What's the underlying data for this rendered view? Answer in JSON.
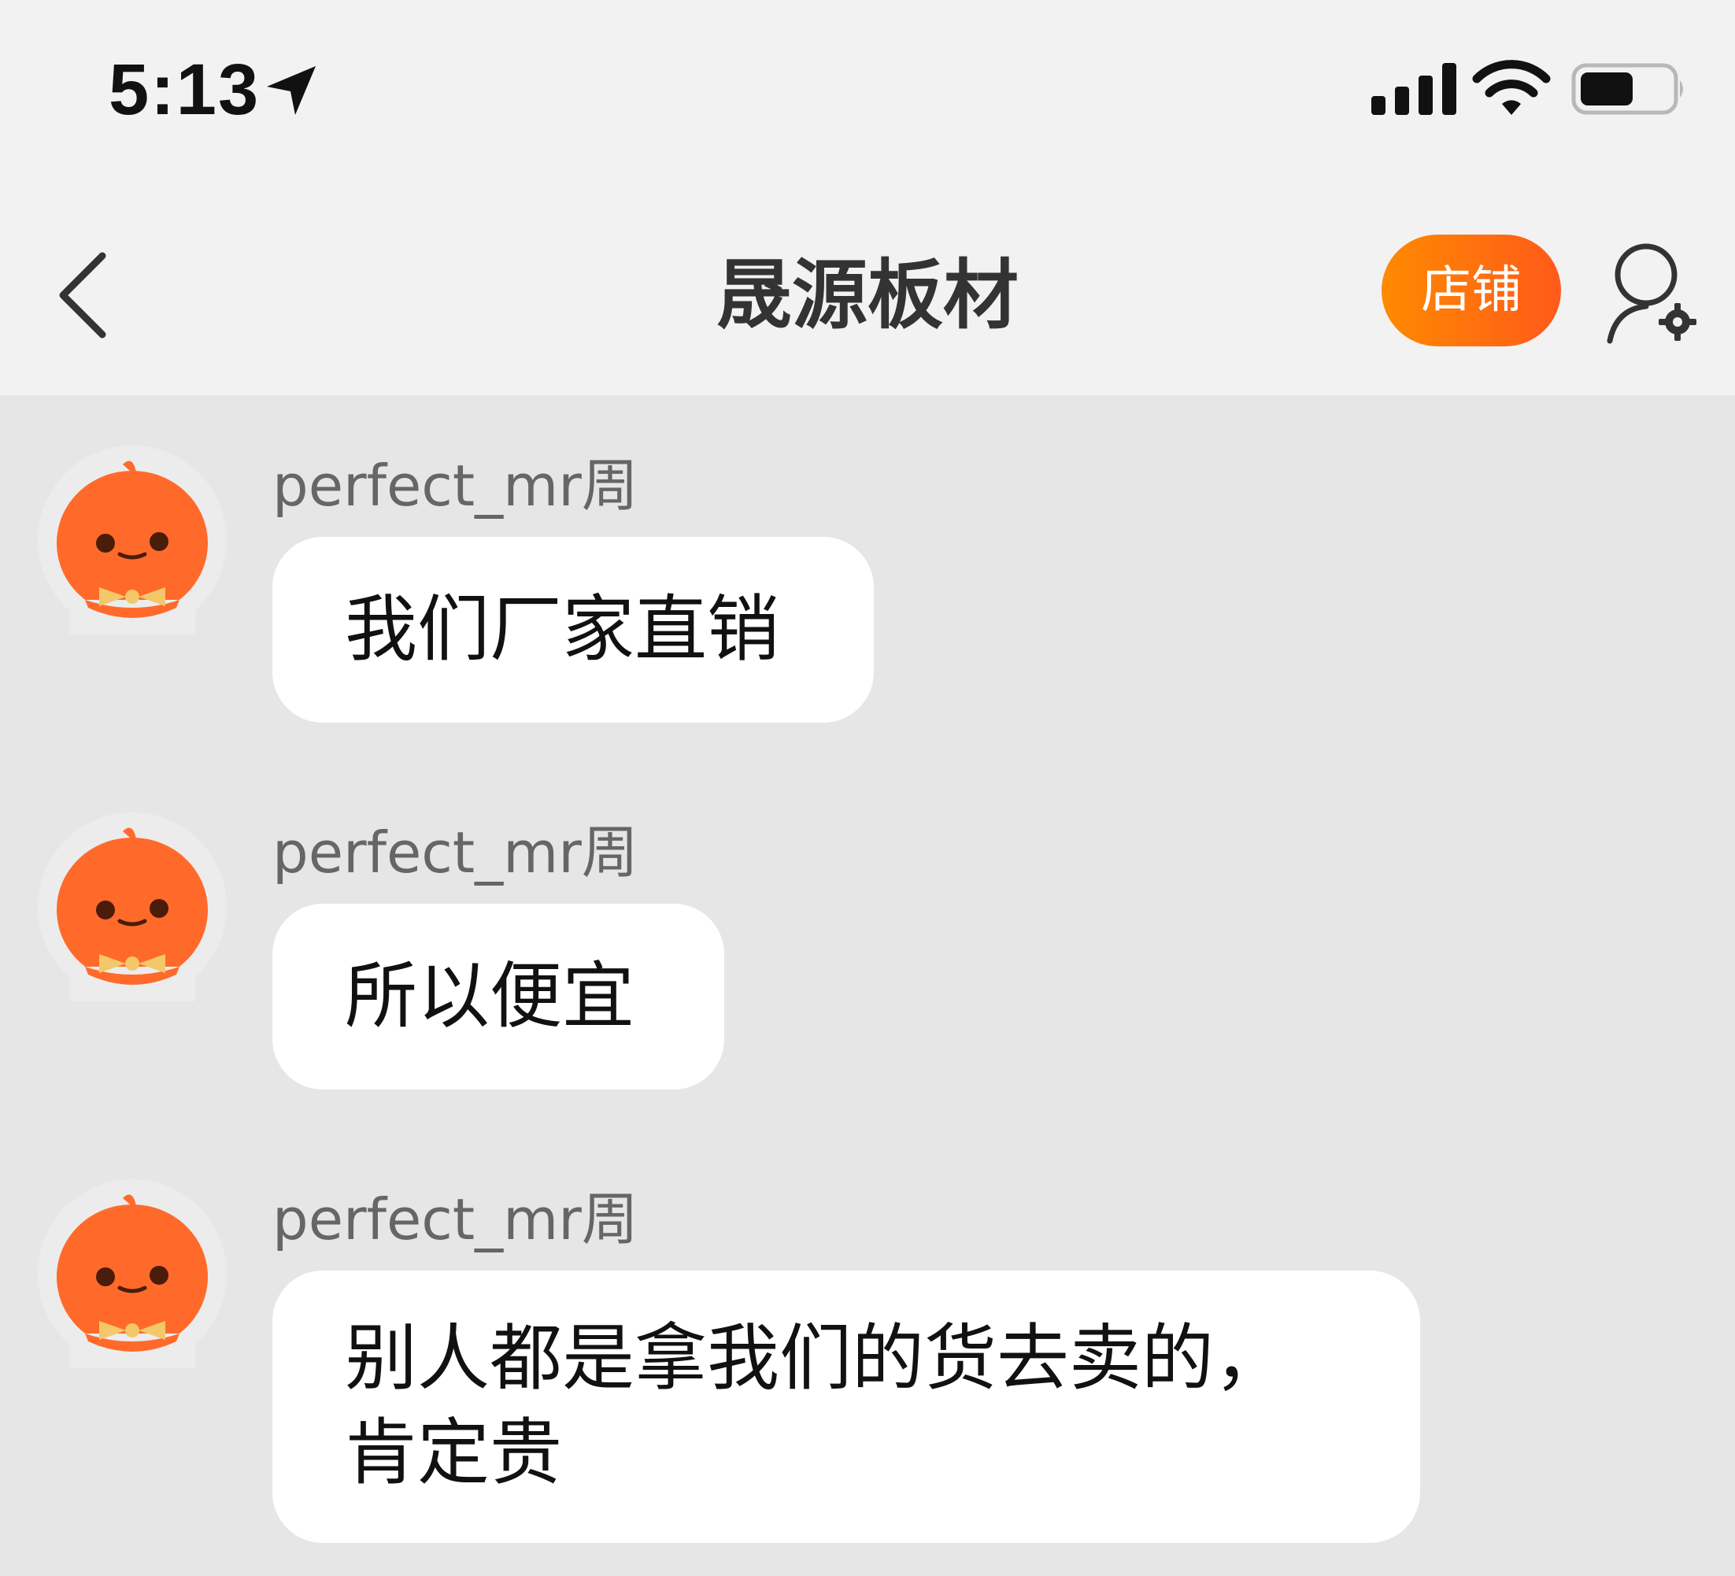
{
  "status_bar": {
    "time": "5:13",
    "icons": [
      "location-arrow-icon",
      "signal-icon",
      "wifi-icon",
      "battery-icon"
    ]
  },
  "nav": {
    "title": "晟源板材",
    "shop_label": "店铺",
    "icons": [
      "back-icon",
      "user-settings-icon"
    ]
  },
  "colors": {
    "accent": "#ff6a0e",
    "avatar": "#ff6a2b",
    "bubble": "#ffffff",
    "background": "#e6e6e6"
  },
  "messages": [
    {
      "sender": "perfect_mr周",
      "lines": [
        "我们厂家直销"
      ]
    },
    {
      "sender": "perfect_mr周",
      "lines": [
        "所以便宜"
      ]
    },
    {
      "sender": "perfect_mr周",
      "lines": [
        "别人都是拿我们的货去卖的，",
        "肯定贵"
      ]
    }
  ]
}
